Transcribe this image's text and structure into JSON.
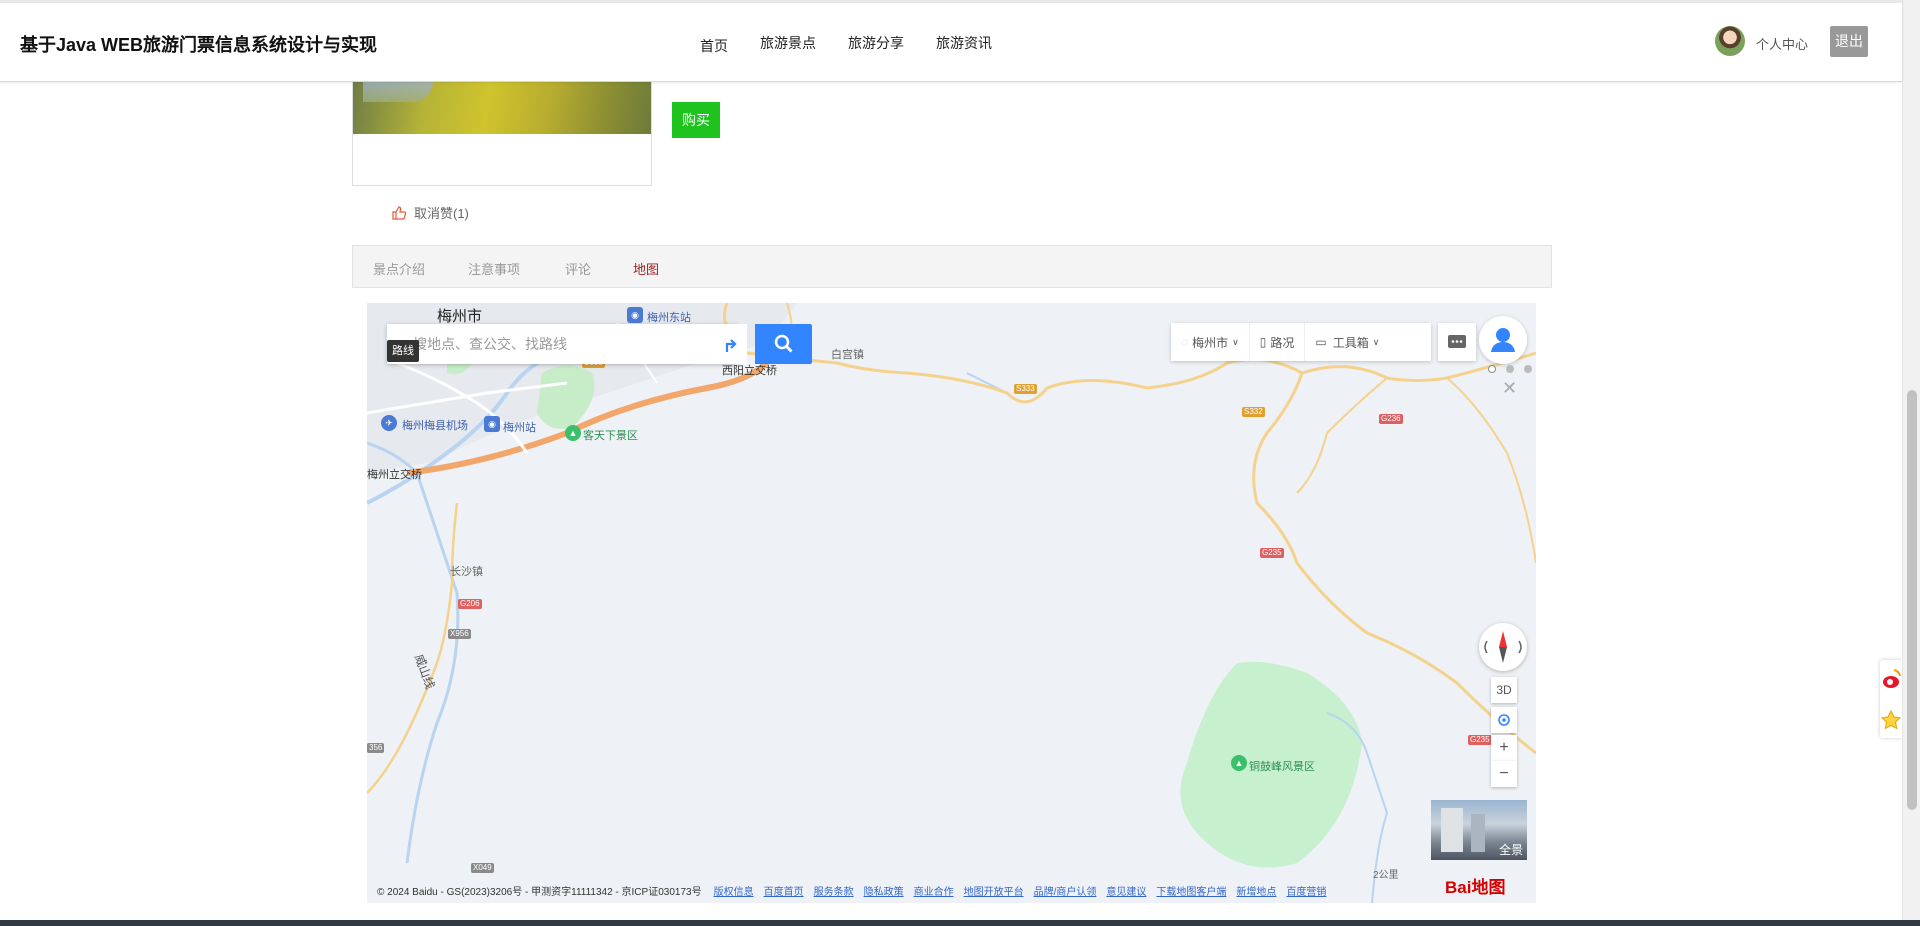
{
  "header": {
    "site_title": "基于Java WEB旅游门票信息系统设计与实现",
    "nav": [
      "首页",
      "旅游景点",
      "旅游分享",
      "旅游资讯"
    ],
    "user_link": "个人中心",
    "logout": "退出"
  },
  "product": {
    "buy_label": "购买",
    "like_label": "取消赞(1)"
  },
  "tabs": [
    "景点介绍",
    "注意事项",
    "评论",
    "地图"
  ],
  "active_tab": "地图",
  "map": {
    "search_placeholder": "搜地点、查公交、找路线",
    "route_tooltip": "路线",
    "toolbar": {
      "city": "梅州市",
      "traffic": "路况",
      "toolbox": "工具箱"
    },
    "controls": {
      "three_d": "3D",
      "zoom_in": "+",
      "zoom_out": "−",
      "close": "✕"
    },
    "panorama_label": "全景",
    "labels": {
      "city": "梅州市",
      "east_station": "梅州东站",
      "xiyang": "西阳立交桥",
      "baigong": "白宫镇",
      "airport": "梅州梅县机场",
      "station": "梅州站",
      "kejia": "客天下景区",
      "lijiao": "梅州立交桥",
      "changsha": "长沙镇",
      "weishan": "威山线",
      "tonggu": "铜鼓峰风景区"
    },
    "shields": {
      "s333": "S333",
      "s332": "S332",
      "g236": "G236",
      "g235": "G235",
      "g206": "G206",
      "x956": "X956",
      "g235b": "G235",
      "s333b": "S333",
      "x049": "X049",
      "s56": "356",
      "s_small": "S"
    },
    "footer_copyright": "© 2024 Baidu - GS(2023)3206号 - 甲测资字11111342 - 京ICP证030173号",
    "footer_links": [
      "版权信息",
      "百度首页",
      "服务条款",
      "隐私政策",
      "商业合作",
      "地图开放平台",
      "品牌/商户认领",
      "意见建议",
      "下载地图客户端",
      "新增地点",
      "百度营销"
    ],
    "scale_text": "2公里",
    "logo": "Bai地图"
  },
  "colors": {
    "buy_green": "#1ec31e",
    "active_tab": "#9c1e1e",
    "search_blue": "#3385ff",
    "logout_gray": "#999999"
  }
}
